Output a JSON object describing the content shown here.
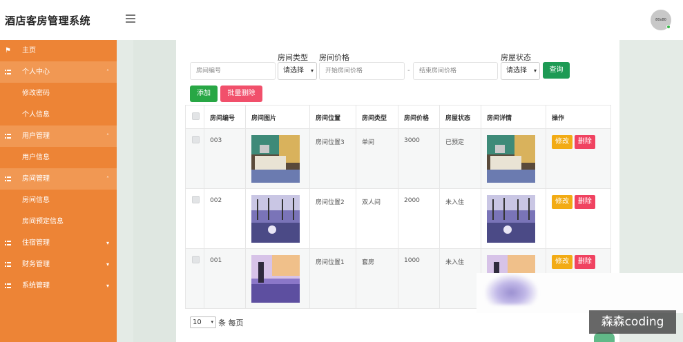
{
  "app": {
    "title": "酒店客房管理系统",
    "avatar_text": "80x80"
  },
  "sidebar": {
    "items": [
      {
        "label": "主页",
        "icon": "flag-icon",
        "type": "top"
      },
      {
        "label": "个人中心",
        "icon": "grid-icon",
        "type": "group",
        "caret": "˄"
      },
      {
        "label": "修改密码",
        "type": "sub"
      },
      {
        "label": "个人信息",
        "type": "sub"
      },
      {
        "label": "用户管理",
        "icon": "grid-icon",
        "type": "group",
        "caret": "˄"
      },
      {
        "label": "用户信息",
        "type": "sub"
      },
      {
        "label": "房间管理",
        "icon": "grid-icon",
        "type": "group",
        "caret": "˄"
      },
      {
        "label": "房间信息",
        "type": "sub"
      },
      {
        "label": "房间预定信息",
        "type": "sub"
      },
      {
        "label": "住宿管理",
        "icon": "grid-icon",
        "type": "top",
        "caret": "▾"
      },
      {
        "label": "财务管理",
        "icon": "grid-icon",
        "type": "top",
        "caret": "▾"
      },
      {
        "label": "系统管理",
        "icon": "grid-icon",
        "type": "top",
        "caret": "▾"
      }
    ],
    "color": "#ed8436"
  },
  "search": {
    "room_type_label": "房间类型",
    "price_label": "房间价格",
    "status_label": "房屋状态",
    "room_no_placeholder": "房间编号",
    "room_type_select": "请选择",
    "price_min_placeholder": "开始房间价格",
    "price_sep": "-",
    "price_max_placeholder": "结束房间价格",
    "status_select": "请选择",
    "query_button": "查询"
  },
  "actions": {
    "add": "添加",
    "batch_delete": "批量删除"
  },
  "table": {
    "headers": [
      "房间编号",
      "房间图片",
      "房间位置",
      "房间类型",
      "房间价格",
      "房屋状态",
      "房间详情",
      "操作"
    ],
    "rows": [
      {
        "id": "003",
        "location": "房间位置3",
        "type": "单间",
        "price": "3000",
        "status": "已预定",
        "edit": "修改",
        "del": "删除"
      },
      {
        "id": "002",
        "location": "房间位置2",
        "type": "双人间",
        "price": "2000",
        "status": "未入住",
        "edit": "修改",
        "del": "删除"
      },
      {
        "id": "001",
        "location": "房间位置1",
        "type": "套房",
        "price": "1000",
        "status": "未入住",
        "edit": "修改",
        "del": "删除"
      }
    ]
  },
  "pager": {
    "page_size": "10",
    "per_page_text": "条 每页"
  },
  "watermark": "森森coding"
}
